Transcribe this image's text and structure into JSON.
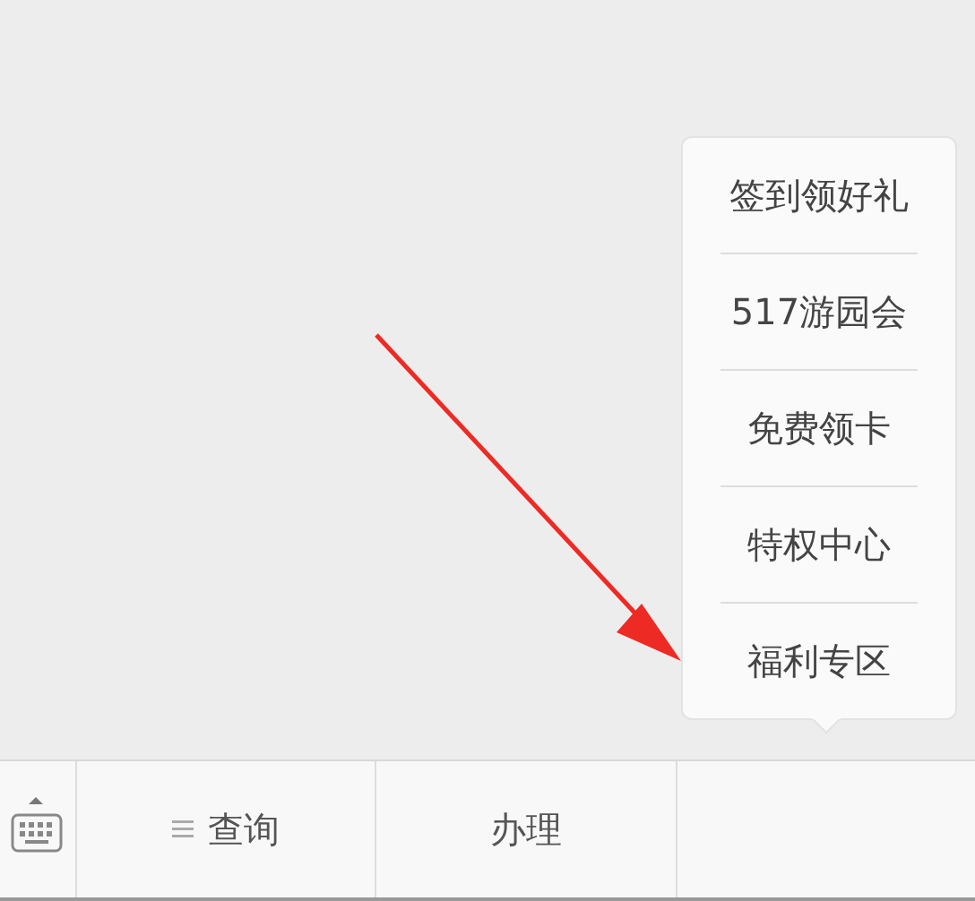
{
  "popup_menu": {
    "items": [
      "签到领好礼",
      "517游园会",
      "免费领卡",
      "特权中心",
      "福利专区"
    ]
  },
  "annotation": {
    "kind": "arrow"
  },
  "bottom_bar": {
    "tabs": [
      {
        "label": "查询",
        "menu_icon": true
      },
      {
        "label": "办理",
        "menu_icon": false
      }
    ]
  }
}
